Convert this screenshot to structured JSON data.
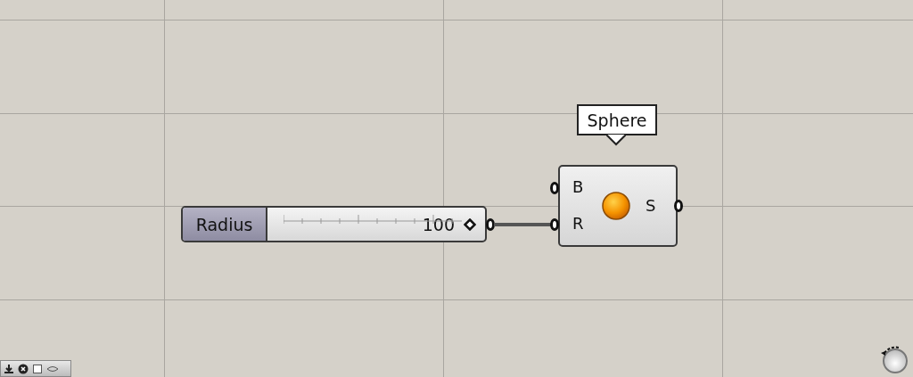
{
  "slider": {
    "label": "Radius",
    "value": "100",
    "level": 1
  },
  "component": {
    "tooltip": "Sphere",
    "inputs": [
      "B",
      "R"
    ],
    "outputs": [
      "S"
    ]
  }
}
